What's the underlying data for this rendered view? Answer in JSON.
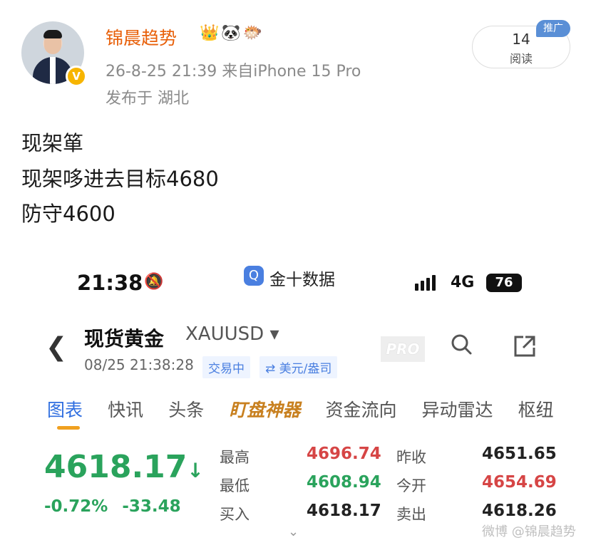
{
  "post": {
    "author": "锦晨趋势",
    "badges": "👑🐼🐡",
    "verified_mark": "V",
    "meta": "26-8-25 21:39  来自iPhone 15 Pro",
    "location": "发布于 湖北",
    "reads_count": "14",
    "reads_label": "阅读",
    "promo_label": "推广",
    "lines": [
      "现架箪",
      "现架哆进去目标4680",
      "防守4600"
    ]
  },
  "screenshot": {
    "status": {
      "time": "21:38",
      "network": "4G",
      "battery": "76"
    },
    "app_name": "金十数据",
    "header": {
      "title": "现货黄金",
      "symbol": "XAUUSD ▾",
      "datetime": "08/25 21:38:28",
      "status_chip": "交易中",
      "currency_chip": "⇄ 美元/盎司",
      "pro_label": "PRO"
    },
    "tabs": [
      "图表",
      "快讯",
      "头条",
      "盯盘神器",
      "资金流向",
      "异动雷达",
      "枢纽"
    ],
    "quote": {
      "price": "4618.17",
      "arrow": "↓",
      "change_pct": "-0.72%",
      "change_abs": "-33.48",
      "stats": [
        {
          "label": "最高",
          "value": "4696.74",
          "label2": "昨收",
          "value2": "4651.65"
        },
        {
          "label": "最低",
          "value": "4608.94",
          "label2": "今开",
          "value2": "4654.69"
        },
        {
          "label": "买入",
          "value": "4618.17",
          "label2": "卖出",
          "value2": "4618.26"
        }
      ]
    },
    "colors": {
      "up": "#d64545",
      "down": "#2aa35c",
      "accent": "#2f6ee0",
      "brand": "#e8600a"
    }
  },
  "watermark": "微博 @锦晨趋势"
}
